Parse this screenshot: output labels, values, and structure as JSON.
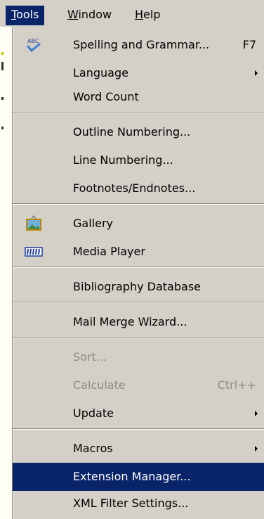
{
  "menubar": {
    "tools": "Tools",
    "window": "Window",
    "help": "Help"
  },
  "tools_menu": {
    "spelling": {
      "label": "Spelling and Grammar...",
      "shortcut": "F7"
    },
    "language": {
      "label": "Language"
    },
    "word_count": {
      "label": "Word Count"
    },
    "outline_numbering": {
      "label": "Outline Numbering..."
    },
    "line_numbering": {
      "label": "Line Numbering..."
    },
    "footnotes": {
      "label": "Footnotes/Endnotes..."
    },
    "gallery": {
      "label": "Gallery"
    },
    "media_player": {
      "label": "Media Player"
    },
    "bibliography": {
      "label": "Bibliography Database"
    },
    "mail_merge": {
      "label": "Mail Merge Wizard..."
    },
    "sort": {
      "label": "Sort..."
    },
    "calculate": {
      "label": "Calculate",
      "shortcut": "Ctrl++"
    },
    "update": {
      "label": "Update"
    },
    "macros": {
      "label": "Macros"
    },
    "extension_manager": {
      "label": "Extension Manager..."
    },
    "xml_filter": {
      "label": "XML Filter Settings..."
    }
  },
  "icons": {
    "spelling": "abc-check-icon",
    "gallery": "gallery-picture-icon",
    "media_player": "media-player-icon"
  },
  "colors": {
    "menu_bg": "#d4d0c8",
    "highlight": "#0a246a",
    "disabled_text": "#8e8b86"
  }
}
